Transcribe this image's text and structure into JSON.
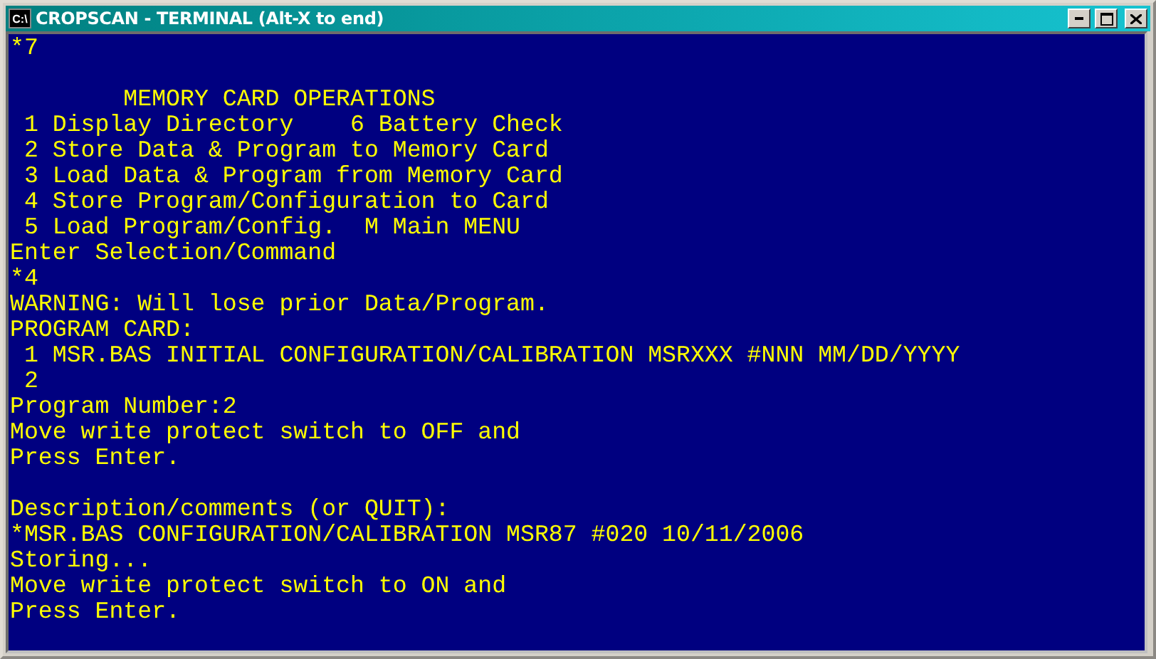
{
  "window": {
    "icon_text": "C:\\",
    "title": "CROPSCAN - TERMINAL (Alt-X to end)",
    "buttons": [
      {
        "kind": "minimize"
      },
      {
        "kind": "maximize"
      },
      {
        "kind": "close"
      }
    ]
  },
  "terminal": {
    "blocks": [
      [
        "*7"
      ],
      [
        "        MEMORY CARD OPERATIONS",
        " 1 Display Directory    6 Battery Check",
        " 2 Store Data & Program to Memory Card",
        " 3 Load Data & Program from Memory Card",
        " 4 Store Program/Configuration to Card",
        " 5 Load Program/Config.  M Main MENU",
        "Enter Selection/Command",
        "*4",
        "WARNING: Will lose prior Data/Program.",
        "PROGRAM CARD:",
        " 1 MSR.BAS INITIAL CONFIGURATION/CALIBRATION MSRXXX #NNN MM/DD/YYYY",
        " 2",
        "Program Number:2",
        "Move write protect switch to OFF and",
        "Press Enter."
      ],
      [
        "Description/comments (or QUIT):",
        "*MSR.BAS CONFIGURATION/CALIBRATION MSR87 #020 10/11/2006",
        "Storing...",
        "Move write protect switch to ON and",
        "Press Enter."
      ]
    ]
  }
}
